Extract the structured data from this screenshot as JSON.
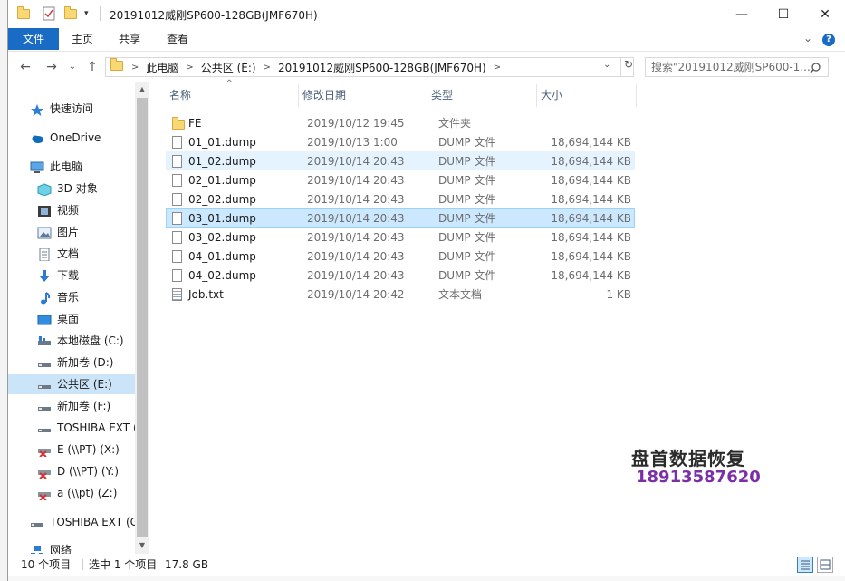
{
  "window": {
    "title": "20191012威刚SP600-128GB(JMF670H)",
    "controls": {
      "minimize": "—",
      "maximize": "☐",
      "close": "✕"
    }
  },
  "ribbon": {
    "tabs": [
      "文件",
      "主页",
      "共享",
      "查看"
    ],
    "help": "?",
    "expand": "⌄"
  },
  "address": {
    "segments": [
      "此电脑",
      "公共区 (E:)",
      "20191012威刚SP600-128GB(JMF670H)"
    ],
    "search_placeholder": "搜索\"20191012威刚SP600-1..."
  },
  "nav": {
    "back": "←",
    "forward": "→",
    "recent": "⌄",
    "up": "↑",
    "refresh": "↻",
    "dropdown": "⌄",
    "items": [
      {
        "label": "快速访问",
        "icon": "star-icon"
      },
      {
        "label": "OneDrive",
        "icon": "cloud-icon"
      },
      {
        "label": "此电脑",
        "icon": "computer-icon"
      },
      {
        "label": "3D 对象",
        "icon": "cube-icon"
      },
      {
        "label": "视频",
        "icon": "video-icon"
      },
      {
        "label": "图片",
        "icon": "picture-icon"
      },
      {
        "label": "文档",
        "icon": "document-icon"
      },
      {
        "label": "下载",
        "icon": "download-icon"
      },
      {
        "label": "音乐",
        "icon": "music-icon"
      },
      {
        "label": "桌面",
        "icon": "desktop-icon"
      },
      {
        "label": "本地磁盘 (C:)",
        "icon": "drive-icon"
      },
      {
        "label": "新加卷 (D:)",
        "icon": "drive-icon"
      },
      {
        "label": "公共区 (E:)",
        "icon": "drive-icon"
      },
      {
        "label": "新加卷 (F:)",
        "icon": "drive-icon"
      },
      {
        "label": "TOSHIBA EXT (",
        "icon": "drive-icon"
      },
      {
        "label": "E (\\\\PT) (X:)",
        "icon": "network-drive-disconnected-icon"
      },
      {
        "label": "D (\\\\PT) (Y:)",
        "icon": "network-drive-disconnected-icon"
      },
      {
        "label": "a (\\\\pt) (Z:)",
        "icon": "network-drive-disconnected-icon"
      },
      {
        "label": "TOSHIBA EXT (G",
        "icon": "drive-icon"
      },
      {
        "label": "网络",
        "icon": "network-icon"
      }
    ]
  },
  "columns": {
    "name": "名称",
    "date": "修改日期",
    "type": "类型",
    "size": "大小"
  },
  "files": [
    {
      "name": "FE",
      "date": "2019/10/12 19:45",
      "type": "文件夹",
      "size": "",
      "kind": "folder"
    },
    {
      "name": "01_01.dump",
      "date": "2019/10/13 1:00",
      "type": "DUMP 文件",
      "size": "18,694,144 KB",
      "kind": "file"
    },
    {
      "name": "01_02.dump",
      "date": "2019/10/14 20:43",
      "type": "DUMP 文件",
      "size": "18,694,144 KB",
      "kind": "file"
    },
    {
      "name": "02_01.dump",
      "date": "2019/10/14 20:43",
      "type": "DUMP 文件",
      "size": "18,694,144 KB",
      "kind": "file"
    },
    {
      "name": "02_02.dump",
      "date": "2019/10/14 20:43",
      "type": "DUMP 文件",
      "size": "18,694,144 KB",
      "kind": "file"
    },
    {
      "name": "03_01.dump",
      "date": "2019/10/14 20:43",
      "type": "DUMP 文件",
      "size": "18,694,144 KB",
      "kind": "file"
    },
    {
      "name": "03_02.dump",
      "date": "2019/10/14 20:43",
      "type": "DUMP 文件",
      "size": "18,694,144 KB",
      "kind": "file"
    },
    {
      "name": "04_01.dump",
      "date": "2019/10/14 20:43",
      "type": "DUMP 文件",
      "size": "18,694,144 KB",
      "kind": "file"
    },
    {
      "name": "04_02.dump",
      "date": "2019/10/14 20:43",
      "type": "DUMP 文件",
      "size": "18,694,144 KB",
      "kind": "file"
    },
    {
      "name": "Job.txt",
      "date": "2019/10/14 20:42",
      "type": "文本文档",
      "size": "1 KB",
      "kind": "text"
    }
  ],
  "status": {
    "count": "10 个项目",
    "selection": "选中 1 个项目",
    "size": "17.8 GB"
  },
  "watermark": {
    "line1": "盘首数据恢复",
    "line2": "18913587620"
  }
}
